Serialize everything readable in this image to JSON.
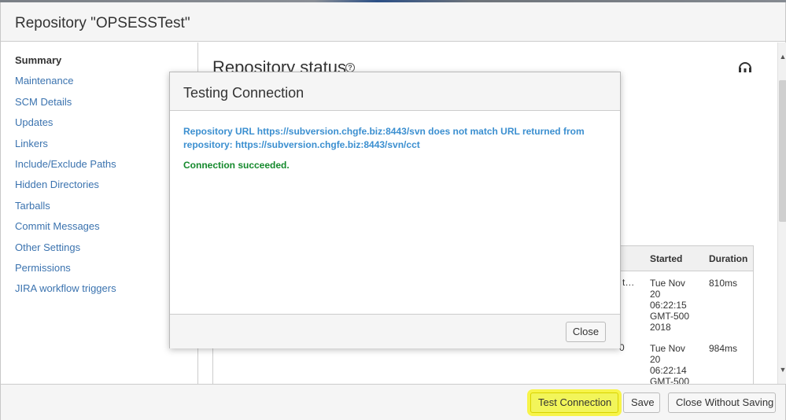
{
  "dialog": {
    "title": "Repository \"OPSESSTest\""
  },
  "sidebar": {
    "items": [
      {
        "label": "Summary",
        "active": true
      },
      {
        "label": "Maintenance"
      },
      {
        "label": "SCM Details"
      },
      {
        "label": "Updates"
      },
      {
        "label": "Linkers"
      },
      {
        "label": "Include/Exclude Paths"
      },
      {
        "label": "Hidden Directories"
      },
      {
        "label": "Tarballs"
      },
      {
        "label": "Commit Messages"
      },
      {
        "label": "Other Settings"
      },
      {
        "label": "Permissions"
      },
      {
        "label": "JIRA workflow triggers"
      }
    ]
  },
  "main": {
    "heading": "Repository status",
    "table": {
      "columns": [
        "Started",
        "Duration"
      ],
      "rows": [
        {
          "partial": "t…",
          "started": "Tue Nov 20 06:22:15 GMT-500 2018",
          "duration": "810ms"
        },
        {
          "partial": "0",
          "started": "Tue Nov 20 06:22:14 GMT-500",
          "duration": "984ms"
        }
      ]
    }
  },
  "footer": {
    "test_connection": "Test Connection",
    "save": "Save",
    "close_without_saving": "Close Without Saving"
  },
  "modal": {
    "title": "Testing Connection",
    "warning": "Repository URL https://subversion.chgfe.biz:8443/svn does not match URL returned from repository: https://subversion.chgfe.biz:8443/svn/cct",
    "success": "Connection succeeded.",
    "close": "Close"
  },
  "colors": {
    "link": "#3b73af",
    "warning_text": "#3b8fd0",
    "success_text": "#14892c",
    "highlight": "#f2f55a"
  }
}
